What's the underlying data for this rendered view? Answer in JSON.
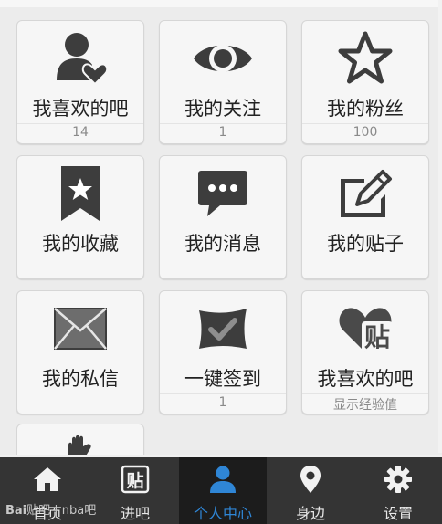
{
  "colors": {
    "icon": "#3d3d3d",
    "active_tab": "#2f86d6",
    "tabbar_bg": "#343434"
  },
  "tiles": [
    {
      "label": "我喜欢的吧",
      "sub": "14",
      "icon": "user-heart-icon"
    },
    {
      "label": "我的关注",
      "sub": "1",
      "icon": "eye-icon"
    },
    {
      "label": "我的粉丝",
      "sub": "100",
      "icon": "star-icon"
    },
    {
      "label": "我的收藏",
      "icon": "bookmark-star-icon"
    },
    {
      "label": "我的消息",
      "icon": "chat-bubble-icon"
    },
    {
      "label": "我的贴子",
      "icon": "edit-icon"
    },
    {
      "label": "我的私信",
      "icon": "envelope-icon"
    },
    {
      "label": "一键签到",
      "sub": "1",
      "icon": "sign-in-check-icon"
    },
    {
      "label": "我喜欢的吧",
      "sub": "显示经验值",
      "icon": "heart-tie-icon"
    }
  ],
  "tabs": [
    {
      "label": "首页",
      "icon": "home-icon"
    },
    {
      "label": "进吧",
      "icon": "tie-icon"
    },
    {
      "label": "个人中心",
      "icon": "person-icon",
      "active": true
    },
    {
      "label": "身边",
      "icon": "location-icon"
    },
    {
      "label": "设置",
      "icon": "gear-icon"
    }
  ],
  "watermark": {
    "brand": "Bai",
    "text": "贴吧 | nba吧"
  }
}
